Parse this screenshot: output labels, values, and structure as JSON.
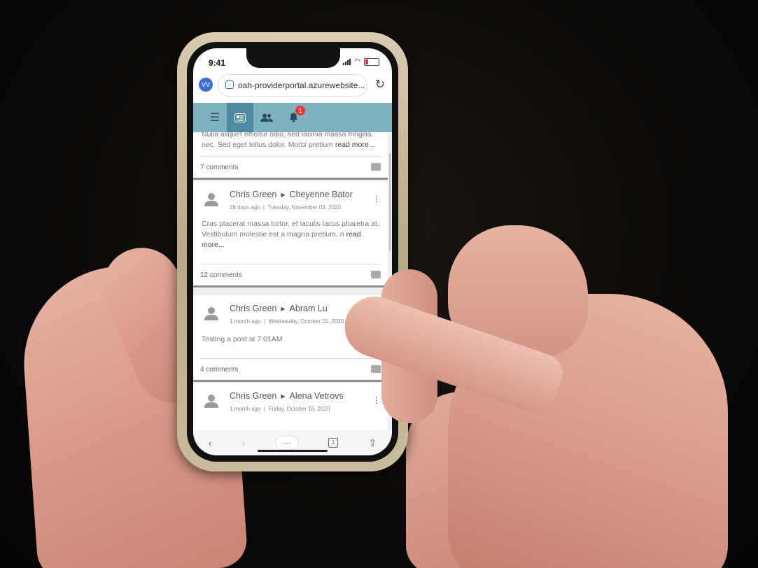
{
  "status": {
    "time": "9:41"
  },
  "browser": {
    "account_initials": "VV",
    "url": "oah-providerportal.azurewebsite..."
  },
  "appbar": {
    "notification_count": "1"
  },
  "feed": {
    "top_post": {
      "text": "Nulla aliquet efficitur odio, sed lacinia massa fringilla nec. Sed eget tellus dolor. Morbi pretium",
      "read_more": "read more...",
      "comments": "7 comments"
    },
    "posts": [
      {
        "author": "Chris Green",
        "recipient": "Cheyenne Bator",
        "relative_time": "28 days ago",
        "date": "Tuesday, November 03, 2020",
        "text": "Cras placerat massa tortor, et iaculis lacus pharetra at. Vestibulum molestie est a magna pretium, n",
        "read_more": "read more...",
        "comments": "12 comments"
      },
      {
        "author": "Chris Green",
        "recipient": "Abram Lu",
        "relative_time": "1 month ago",
        "date": "Wednesday, October 21, 2020",
        "text": "Testing a post at 7:01AM",
        "read_more": "",
        "comments": "4 comments"
      },
      {
        "author": "Chris Green",
        "recipient": "Alena Vetrovs",
        "relative_time": "1 month ago",
        "date": "Friday, October 16, 2020",
        "text": "",
        "read_more": "",
        "comments": ""
      }
    ]
  },
  "bottombar": {
    "more_label": "···",
    "tab_count": "1"
  },
  "colors": {
    "appbar": "#7fb1c1",
    "appbar_active": "#4e8aa0",
    "badge": "#e53935"
  }
}
